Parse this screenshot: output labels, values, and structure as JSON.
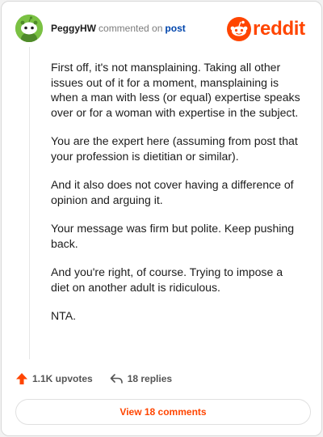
{
  "header": {
    "username": "PeggyHW",
    "meta": "commented on",
    "link": "post"
  },
  "logo": {
    "wordmark": "reddit",
    "icon": "reddit-alien-icon"
  },
  "comment": {
    "paragraphs": [
      "First off, it's not mansplaining. Taking all other issues out of it for a moment, mansplaining is when a man with less (or equal) expertise speaks over or for a woman with expertise in the subject.",
      "You are the expert here (assuming from post that your profession is dietitian or similar).",
      "And it also does not cover having a difference of opinion and arguing it.",
      "Your message was firm but polite. Keep pushing back.",
      "And you're right, of course. Trying to impose a diet on another adult is ridiculous.",
      "NTA."
    ]
  },
  "actions": {
    "upvotes": "1.1K upvotes",
    "replies": "18 replies"
  },
  "view_button": "View 18 comments",
  "colors": {
    "brand": "#ff4500",
    "link": "#0045ac",
    "avatar": "#7ac143"
  }
}
